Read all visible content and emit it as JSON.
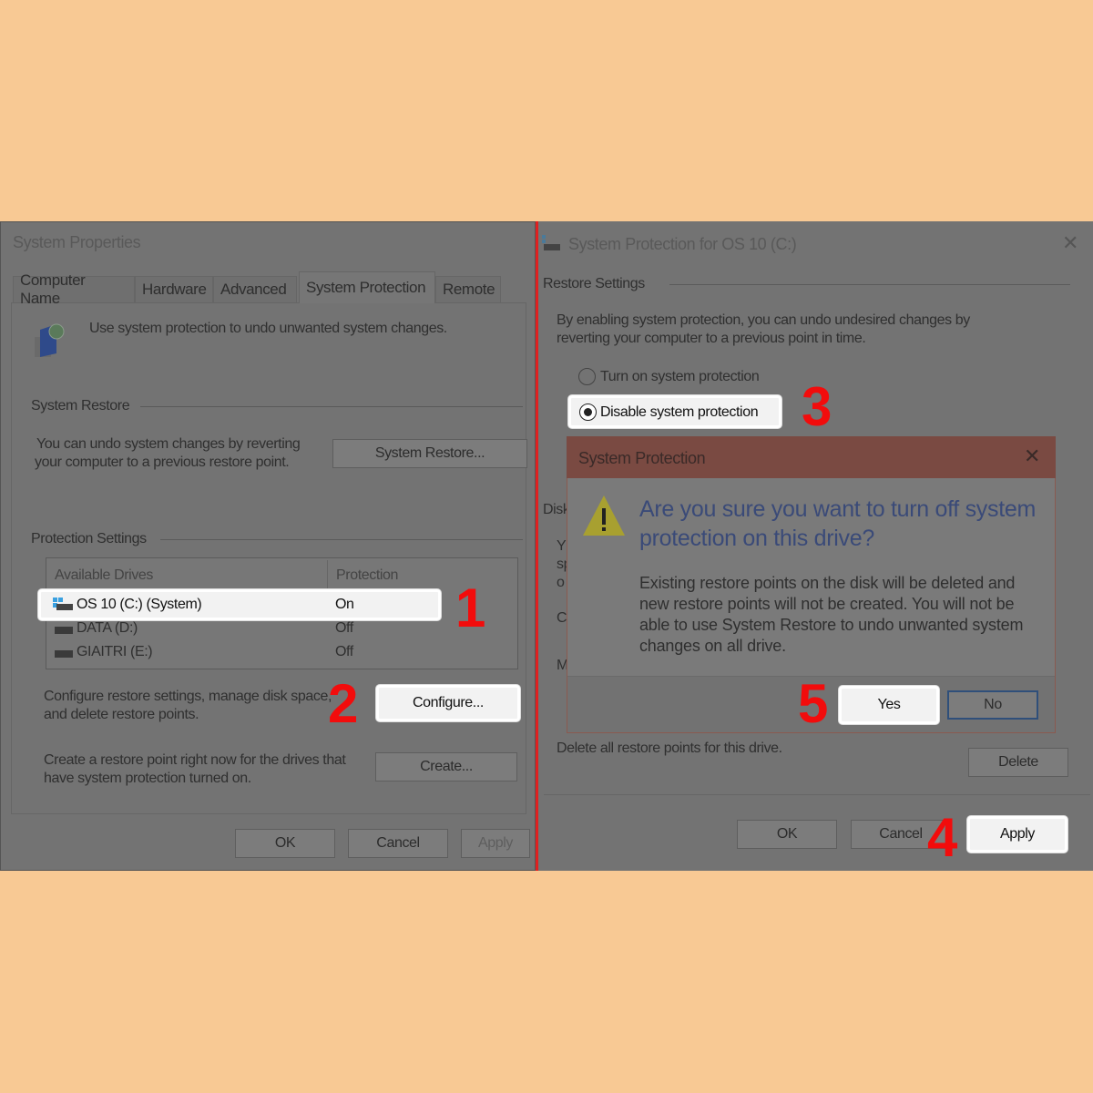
{
  "left": {
    "title": "System Properties",
    "tabs": [
      "Computer Name",
      "Hardware",
      "Advanced",
      "System Protection",
      "Remote"
    ],
    "intro": "Use system protection to undo unwanted system changes.",
    "restore_section": "System Restore",
    "restore_text": [
      "You can undo system changes by reverting",
      "your computer to a previous restore point."
    ],
    "restore_button": "System Restore...",
    "protection_section": "Protection Settings",
    "columns": [
      "Available Drives",
      "Protection"
    ],
    "drives": [
      {
        "name": "OS 10 (C:) (System)",
        "protection": "On"
      },
      {
        "name": "DATA (D:)",
        "protection": "Off"
      },
      {
        "name": "GIAITRI (E:)",
        "protection": "Off"
      }
    ],
    "configure_text": [
      "Configure restore settings, manage disk space,",
      "and delete restore points."
    ],
    "configure_button": "Configure...",
    "create_text": [
      "Create a restore point right now for the drives that",
      "have system protection turned on."
    ],
    "create_button": "Create...",
    "ok": "OK",
    "cancel": "Cancel",
    "apply": "Apply"
  },
  "right": {
    "title": "System Protection for OS 10 (C:)",
    "restore_section": "Restore Settings",
    "restore_text": [
      "By enabling system protection, you can undo undesired changes by",
      "reverting your computer to a previous point in time."
    ],
    "option_on": "Turn on system protection",
    "option_off": "Disable system protection",
    "selected": "Disable system protection",
    "disk_partial": "Disk",
    "partial_letters": [
      "Y",
      "sp",
      "o",
      "C",
      "M"
    ],
    "delete_text": "Delete all restore points for this drive.",
    "delete_button": "Delete",
    "ok": "OK",
    "cancel": "Cancel",
    "apply": "Apply"
  },
  "dialog": {
    "title": "System Protection",
    "question": [
      "Are you sure you want to turn off system",
      "protection on this drive?"
    ],
    "body": [
      "Existing restore points on the disk will be deleted and",
      "new restore points will not be created. You will not be",
      "able to use System Restore to undo unwanted system",
      "changes on all drive."
    ],
    "yes": "Yes",
    "no": "No"
  },
  "steps": [
    "1",
    "2",
    "3",
    "4",
    "5"
  ],
  "colors": {
    "background": "#f8c994",
    "step": "#f20c0c",
    "divider": "#e02020",
    "dialog_title": "#7a4a42",
    "question": "#3a4a78"
  }
}
